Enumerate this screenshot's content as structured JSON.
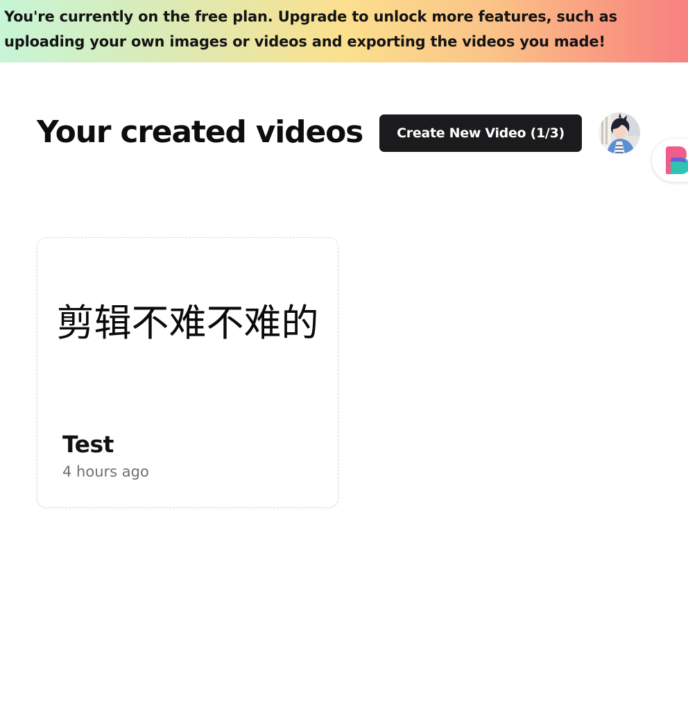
{
  "banner": {
    "text": "You're currently on the free plan. Upgrade to unlock more features, such as\nuploading your own images or videos and exporting the videos you made!"
  },
  "header": {
    "title": "Your created videos",
    "create_button_label": "Create New Video (1/3)",
    "avatar_icon": "user-avatar-icon",
    "widget_icon": "brand-logo-icon"
  },
  "videos": [
    {
      "thumbnail_text": "剪辑不难不难的",
      "title": "Test",
      "time": "4 hours ago"
    }
  ],
  "colors": {
    "button_bg": "#1b1b1d",
    "accent_pink": "#f25c8a",
    "accent_teal": "#2fc4b2",
    "accent_purple": "#6a5de0"
  }
}
